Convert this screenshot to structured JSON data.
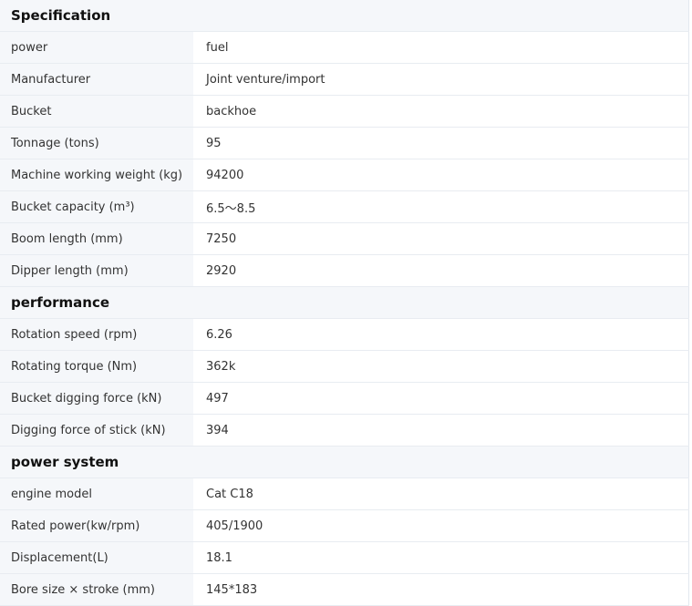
{
  "sections": [
    {
      "title": "Specification",
      "rows": [
        {
          "label": "power",
          "value": "fuel"
        },
        {
          "label": "Manufacturer",
          "value": "Joint venture/import"
        },
        {
          "label": "Bucket",
          "value": "backhoe"
        },
        {
          "label": "Tonnage (tons)",
          "value": "95"
        },
        {
          "label": "Machine working weight (kg)",
          "value": "94200"
        },
        {
          "label": "Bucket capacity (m³)",
          "value": "6.5～8.5"
        },
        {
          "label": "Boom length (mm)",
          "value": "7250"
        },
        {
          "label": "Dipper length (mm)",
          "value": "2920"
        }
      ]
    },
    {
      "title": "performance",
      "rows": [
        {
          "label": "Rotation speed (rpm)",
          "value": "6.26"
        },
        {
          "label": "Rotating torque (Nm)",
          "value": "362k"
        },
        {
          "label": "Bucket digging force (kN)",
          "value": "497"
        },
        {
          "label": "Digging force of stick (kN)",
          "value": "394"
        }
      ]
    },
    {
      "title": "power system",
      "rows": [
        {
          "label": "engine model",
          "value": "Cat C18"
        },
        {
          "label": "Rated power(kw/rpm)",
          "value": "405/1900"
        },
        {
          "label": "Displacement(L)",
          "value": "18.1"
        },
        {
          "label": "Bore size × stroke (mm)",
          "value": "145*183"
        }
      ]
    }
  ]
}
